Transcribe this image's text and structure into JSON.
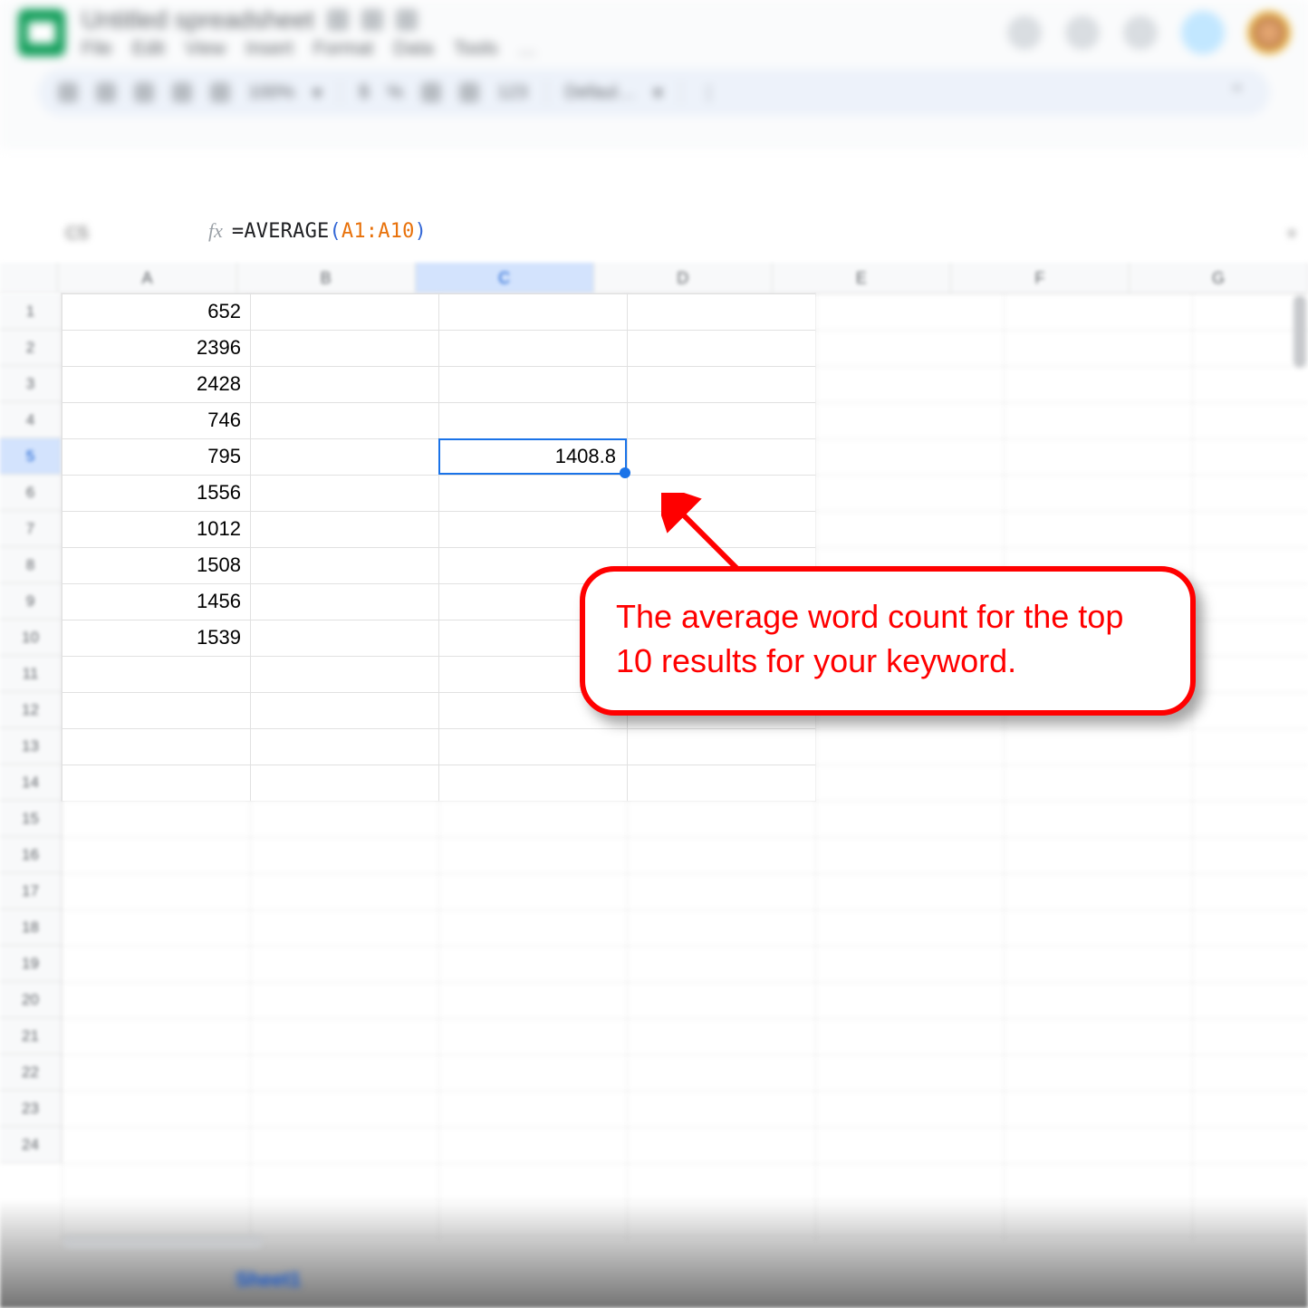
{
  "doc": {
    "title": "Untitled spreadsheet"
  },
  "menu": {
    "file": "File",
    "edit": "Edit",
    "view": "View",
    "insert": "Insert",
    "format": "Format",
    "data": "Data",
    "tools": "Tools",
    "more": "…"
  },
  "toolbar": {
    "zoom": "100%",
    "currency": "$",
    "percent": "%",
    "decdec": ".0",
    "incdec": ".00",
    "num": "123",
    "font": "Defaul…"
  },
  "formula_bar": {
    "cell_ref": "C5",
    "fx_label": "fx",
    "eq": "=",
    "func": "AVERAGE",
    "open": "(",
    "range": "A1:A10",
    "close": ")"
  },
  "columns": [
    "A",
    "B",
    "C",
    "D",
    "E",
    "F",
    "G"
  ],
  "selected_col_index": 2,
  "row_count": 24,
  "selected_row": 5,
  "col_a_values": [
    "652",
    "2396",
    "2428",
    "746",
    "795",
    "1556",
    "1012",
    "1508",
    "1456",
    "1539"
  ],
  "result_cell": {
    "col": "C",
    "row": 5,
    "value": "1408.8"
  },
  "callout_text": "The average word count for the top 10 results for your keyword.",
  "sheet_tab": "Sheet1"
}
